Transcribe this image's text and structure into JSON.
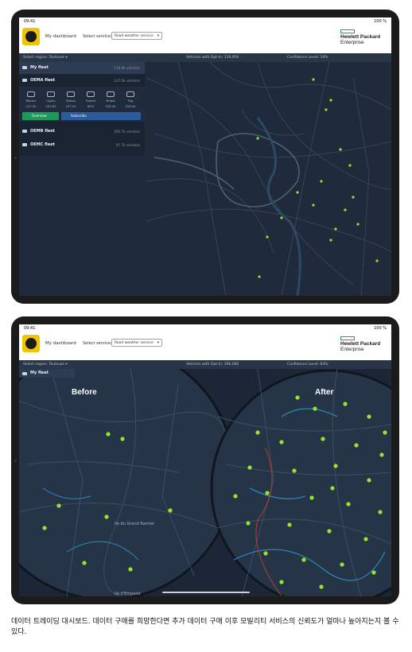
{
  "tablet_top": {
    "status": {
      "time": "09:41",
      "battery": "100 %"
    },
    "nav": {
      "dashboard": "My dashboard",
      "service_label": "Select service:",
      "service_value": "Road weather service"
    },
    "brand": {
      "line1": "Hewlett Packard",
      "line2": "Enterprise"
    },
    "infobar": {
      "region": "Select region: Toulouse",
      "vehicles": "Vehicles with Opt-In: 119,950",
      "confidence": "Confidence Level: 54%"
    },
    "fleets": [
      {
        "label": "My fleet",
        "count": "119.9k vehicles"
      },
      {
        "label": "OEMA fleet",
        "count": "237.5k vehicles"
      },
      {
        "label": "OEMB fleet",
        "count": "350.7k vehicles"
      },
      {
        "label": "OEMC fleet",
        "count": "97.7k vehicles"
      }
    ],
    "metrics": [
      {
        "label": "Wipers",
        "value": "227.5k"
      },
      {
        "label": "Lights",
        "value": "203.0k"
      },
      {
        "label": "Status",
        "value": "237.5k"
      },
      {
        "label": "Speed",
        "value": "60%"
      },
      {
        "label": "Brake",
        "value": "228.4k"
      },
      {
        "label": "Fog",
        "value": "228.4k"
      }
    ],
    "buttons": {
      "overview": "Overview",
      "subscribe": "Subscribe"
    }
  },
  "tablet_bottom": {
    "status": {
      "time": "09:41",
      "battery": "100 %"
    },
    "nav": {
      "dashboard": "My dashboard",
      "service_label": "Select service:",
      "service_value": "Road weather service"
    },
    "brand": {
      "line1": "Hewlett Packard",
      "line2": "Enterprise"
    },
    "infobar": {
      "region": "Select region: Toulouse",
      "vehicles": "Vehicles with Opt-In: 396,080",
      "confidence": "Confidence Level: 84%"
    },
    "fleet_label": "My fleet",
    "lens_before": "Before",
    "lens_after": "After",
    "places": [
      "Ile du Grand Ramier",
      "Ile d'Empalot"
    ]
  },
  "caption": "데이터 트레이딩 대시보드. 데이터 구매를 희망한다면 추가 데이터 구매 이후 모빌리티 서비스의 신뢰도가 얼마나 높아지는지 볼 수 있다.",
  "colors": {
    "map_bg": "#1f2a3a",
    "road": "#3a4b61",
    "dot": "#9be22e",
    "accent": "#01a982",
    "logo": "#f1c400"
  }
}
